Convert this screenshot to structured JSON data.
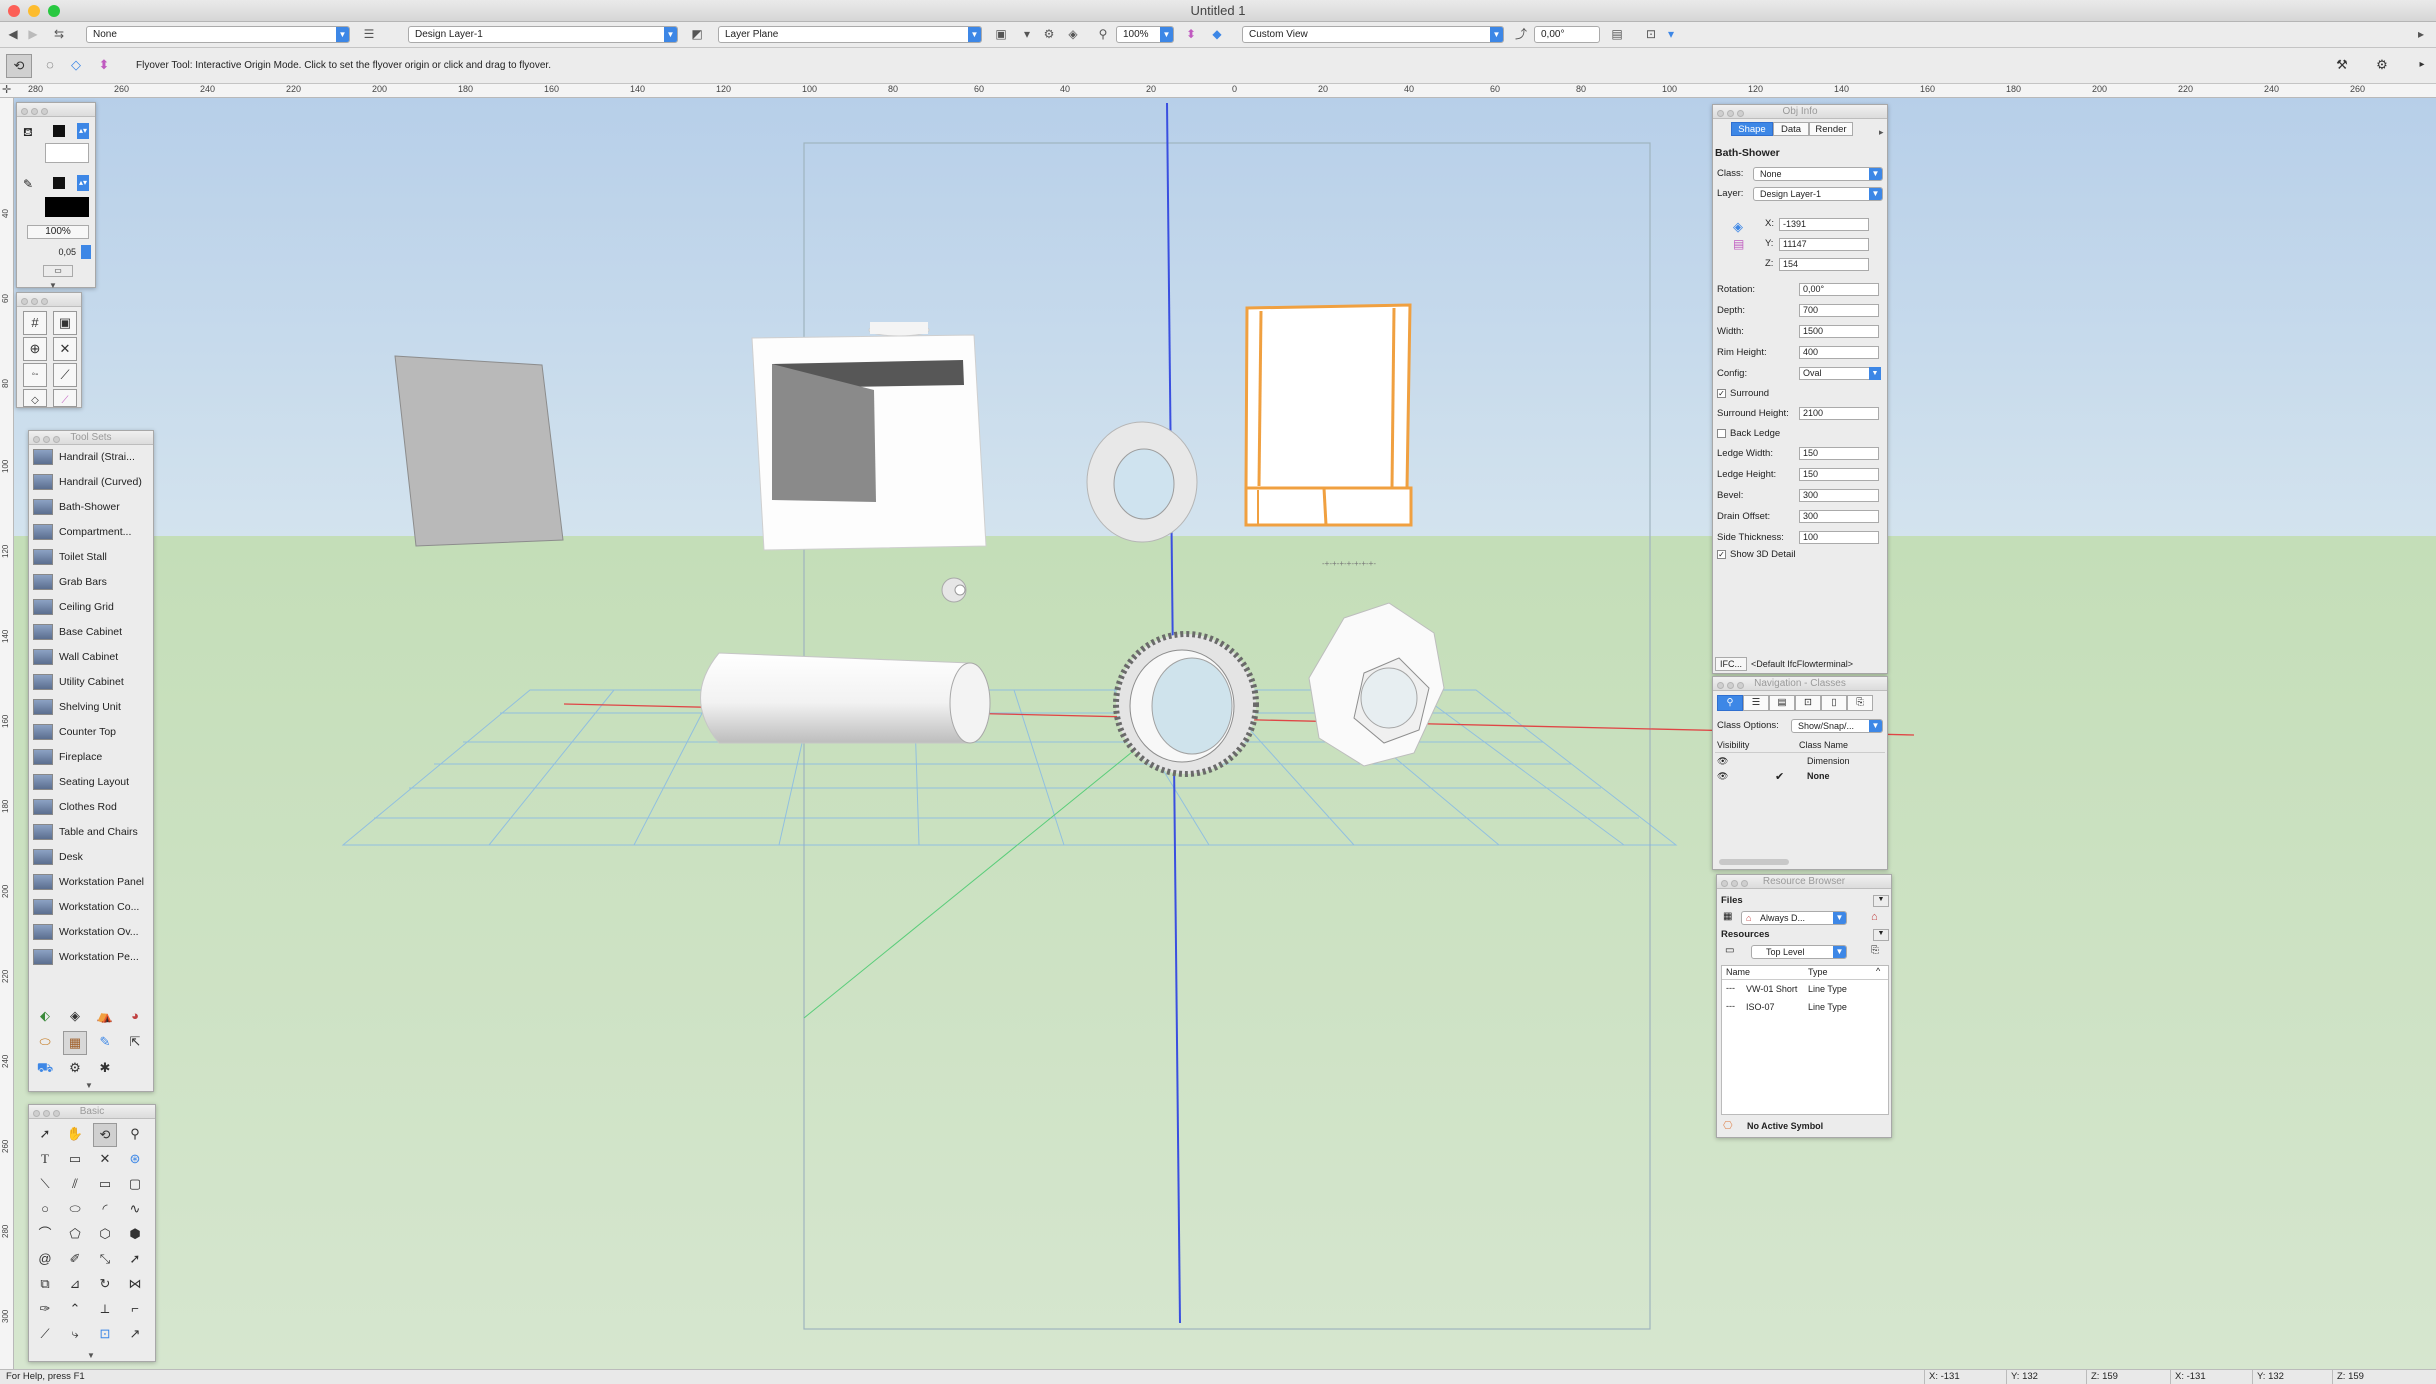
{
  "window": {
    "title": "Untitled 1"
  },
  "view_bar": {
    "class_value": "None",
    "layer_value": "Design Layer-1",
    "plane_value": "Layer Plane",
    "zoom_value": "100%",
    "view_value": "Custom View",
    "rotation_value": "0,00°"
  },
  "mode_bar": {
    "hint": "Flyover Tool: Interactive Origin Mode. Click to set the flyover origin or click and drag to flyover."
  },
  "ruler": {
    "ticks": [
      "280",
      "260",
      "240",
      "220",
      "200",
      "180",
      "160",
      "140",
      "120",
      "100",
      "80",
      "60",
      "40",
      "20",
      "0",
      "20",
      "40",
      "60",
      "80",
      "100",
      "120",
      "140",
      "160",
      "180",
      "200",
      "220",
      "240",
      "260"
    ]
  },
  "vruler": {
    "ticks": [
      "40",
      "60",
      "80",
      "100",
      "120",
      "140",
      "160",
      "180",
      "200",
      "220",
      "240",
      "260",
      "280",
      "300"
    ]
  },
  "attributes": {
    "zoom": "100%",
    "line_weight": "0,05"
  },
  "tool_sets": {
    "title": "Tool Sets",
    "items": [
      "Handrail (Strai...",
      "Handrail (Curved)",
      "Bath-Shower",
      "Compartment...",
      "Toilet Stall",
      "Grab Bars",
      "Ceiling Grid",
      "Base Cabinet",
      "Wall Cabinet",
      "Utility Cabinet",
      "Shelving Unit",
      "Counter Top",
      "Fireplace",
      "Seating Layout",
      "Clothes Rod",
      "Table and Chairs",
      "Desk",
      "Workstation Panel",
      "Workstation Co...",
      "Workstation Ov...",
      "Workstation Pe..."
    ]
  },
  "basic": {
    "title": "Basic"
  },
  "obj_info": {
    "title": "Obj Info",
    "tabs": [
      "Shape",
      "Data",
      "Render"
    ],
    "object_name": "Bath-Shower",
    "class_label": "Class:",
    "class_value": "None",
    "layer_label": "Layer:",
    "layer_value": "Design Layer-1",
    "x_label": "X:",
    "x": "-1391",
    "y_label": "Y:",
    "y": "11147",
    "z_label": "Z:",
    "z": "154",
    "params": [
      {
        "label": "Rotation:",
        "value": "0,00°"
      },
      {
        "label": "Depth:",
        "value": "700"
      },
      {
        "label": "Width:",
        "value": "1500"
      },
      {
        "label": "Rim Height:",
        "value": "400"
      },
      {
        "label": "Config:",
        "value": "Oval"
      }
    ],
    "surround_label": "Surround",
    "surround_height_label": "Surround Height:",
    "surround_height": "2100",
    "back_ledge_label": "Back Ledge",
    "params2": [
      {
        "label": "Ledge Width:",
        "value": "150"
      },
      {
        "label": "Ledge Height:",
        "value": "150"
      },
      {
        "label": "Bevel:",
        "value": "300"
      },
      {
        "label": "Drain Offset:",
        "value": "300"
      },
      {
        "label": "Side Thickness:",
        "value": "100"
      }
    ],
    "show3d_label": "Show 3D Detail",
    "ifc_button": "IFC...",
    "ifc_value": "<Default IfcFlowterminal>"
  },
  "navigation": {
    "title": "Navigation - Classes",
    "class_options_label": "Class Options:",
    "class_options_value": "Show/Snap/...",
    "col_visibility": "Visibility",
    "col_class_name": "Class Name",
    "rows": [
      {
        "name": "Dimension",
        "active": false
      },
      {
        "name": "None",
        "active": true
      }
    ]
  },
  "resource_browser": {
    "title": "Resource Browser",
    "files_label": "Files",
    "files_value": "Always D...",
    "resources_label": "Resources",
    "resources_value": "Top Level",
    "col_name": "Name",
    "col_type": "Type",
    "rows": [
      {
        "name": "VW-01 Short",
        "type": "Line Type"
      },
      {
        "name": "ISO-07",
        "type": "Line Type"
      }
    ],
    "footer": "No Active Symbol"
  },
  "status": {
    "help": "For Help, press F1",
    "coords": [
      "X: -131",
      "Y: 132",
      "Z: 159",
      "X: -131",
      "Y: 132",
      "Z: 159"
    ]
  },
  "colors": {
    "accent": "#3d87e6",
    "sky_top": "#bcd2ea",
    "ground": "#cfe3c5",
    "axis_blue": "#3a4fe0",
    "axis_red": "#e04545",
    "orange": "#f0a040"
  }
}
